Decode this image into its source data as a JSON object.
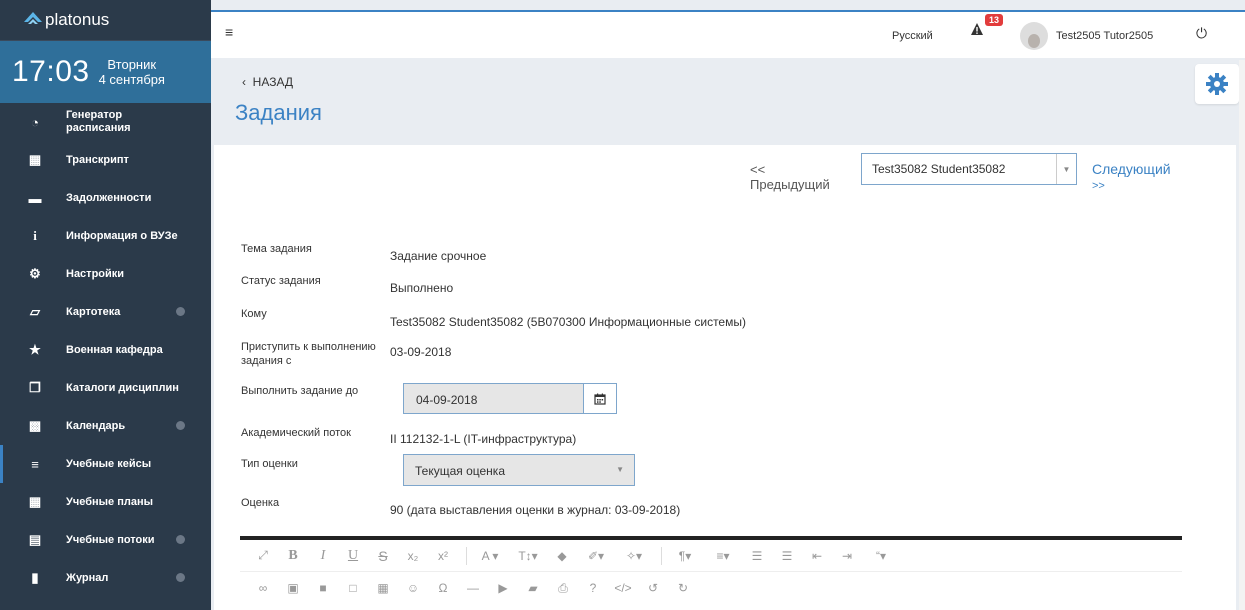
{
  "app": {
    "brand": "platonus"
  },
  "clock": {
    "time": "17:03",
    "weekday": "Вторник",
    "date": "4 сентября"
  },
  "sidebar": {
    "items": [
      {
        "label": "Генератор расписания",
        "icon": "clock-icon"
      },
      {
        "label": "Транскрипт",
        "icon": "table-icon"
      },
      {
        "label": "Задолженности",
        "icon": "inbox-icon"
      },
      {
        "label": "Информация о ВУЗе",
        "icon": "info-icon"
      },
      {
        "label": "Настройки",
        "icon": "gears-icon"
      },
      {
        "label": "Картотека",
        "icon": "folder-open-icon"
      },
      {
        "label": "Военная кафедра",
        "icon": "star-icon"
      },
      {
        "label": "Каталоги дисциплин",
        "icon": "copy-icon"
      },
      {
        "label": "Календарь",
        "icon": "calendar-icon"
      },
      {
        "label": "Учебные кейсы",
        "icon": "list-icon"
      },
      {
        "label": "Учебные планы",
        "icon": "grid-icon"
      },
      {
        "label": "Учебные потоки",
        "icon": "file-icon"
      },
      {
        "label": "Журнал",
        "icon": "book-icon"
      }
    ]
  },
  "topbar": {
    "language": "Русский",
    "notifications": "13",
    "user": "Test2505 Tutor2505"
  },
  "header": {
    "back": "НАЗАД",
    "title": "Задания"
  },
  "navigator": {
    "prev": "<<",
    "prev2": "Предыдущий",
    "student": "Test35082 Student35082",
    "next": "Следующий",
    "next2": ">>"
  },
  "fields": {
    "topic_label": "Тема задания",
    "topic": "Задание срочное",
    "status_label": "Статус задания",
    "status": "Выполнено",
    "to_label": "Кому",
    "to": "Test35082 Student35082 (5B070300 Информационные системы)",
    "start_label1": "Приступить к выполнению",
    "start_label2": "задания с",
    "start": "03-09-2018",
    "due_label": "Выполнить задание до",
    "due": "04-09-2018",
    "stream_label": "Академический поток",
    "stream": "II 112132-1-L (IT-инфраструктура)",
    "grade_type_label": "Тип оценки",
    "grade_type": "Текущая оценка",
    "grade_label": "Оценка",
    "grade": "90 (дата выставления оценки в журнал: 03-09-2018)"
  },
  "colors": {
    "sidebar": "#2b3a4a",
    "accent": "#3b82c4",
    "clock": "#2f6f9a",
    "badge": "#e23c3c"
  }
}
